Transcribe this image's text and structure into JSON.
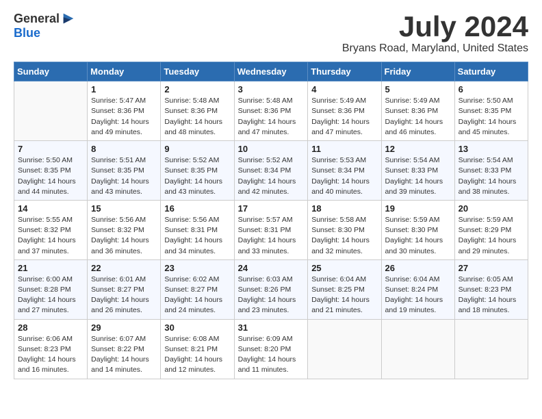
{
  "header": {
    "logo_general": "General",
    "logo_blue": "Blue",
    "month_title": "July 2024",
    "location": "Bryans Road, Maryland, United States"
  },
  "days_of_week": [
    "Sunday",
    "Monday",
    "Tuesday",
    "Wednesday",
    "Thursday",
    "Friday",
    "Saturday"
  ],
  "weeks": [
    [
      {
        "day": "",
        "info": ""
      },
      {
        "day": "1",
        "info": "Sunrise: 5:47 AM\nSunset: 8:36 PM\nDaylight: 14 hours\nand 49 minutes."
      },
      {
        "day": "2",
        "info": "Sunrise: 5:48 AM\nSunset: 8:36 PM\nDaylight: 14 hours\nand 48 minutes."
      },
      {
        "day": "3",
        "info": "Sunrise: 5:48 AM\nSunset: 8:36 PM\nDaylight: 14 hours\nand 47 minutes."
      },
      {
        "day": "4",
        "info": "Sunrise: 5:49 AM\nSunset: 8:36 PM\nDaylight: 14 hours\nand 47 minutes."
      },
      {
        "day": "5",
        "info": "Sunrise: 5:49 AM\nSunset: 8:36 PM\nDaylight: 14 hours\nand 46 minutes."
      },
      {
        "day": "6",
        "info": "Sunrise: 5:50 AM\nSunset: 8:35 PM\nDaylight: 14 hours\nand 45 minutes."
      }
    ],
    [
      {
        "day": "7",
        "info": "Sunrise: 5:50 AM\nSunset: 8:35 PM\nDaylight: 14 hours\nand 44 minutes."
      },
      {
        "day": "8",
        "info": "Sunrise: 5:51 AM\nSunset: 8:35 PM\nDaylight: 14 hours\nand 43 minutes."
      },
      {
        "day": "9",
        "info": "Sunrise: 5:52 AM\nSunset: 8:35 PM\nDaylight: 14 hours\nand 43 minutes."
      },
      {
        "day": "10",
        "info": "Sunrise: 5:52 AM\nSunset: 8:34 PM\nDaylight: 14 hours\nand 42 minutes."
      },
      {
        "day": "11",
        "info": "Sunrise: 5:53 AM\nSunset: 8:34 PM\nDaylight: 14 hours\nand 40 minutes."
      },
      {
        "day": "12",
        "info": "Sunrise: 5:54 AM\nSunset: 8:33 PM\nDaylight: 14 hours\nand 39 minutes."
      },
      {
        "day": "13",
        "info": "Sunrise: 5:54 AM\nSunset: 8:33 PM\nDaylight: 14 hours\nand 38 minutes."
      }
    ],
    [
      {
        "day": "14",
        "info": "Sunrise: 5:55 AM\nSunset: 8:32 PM\nDaylight: 14 hours\nand 37 minutes."
      },
      {
        "day": "15",
        "info": "Sunrise: 5:56 AM\nSunset: 8:32 PM\nDaylight: 14 hours\nand 36 minutes."
      },
      {
        "day": "16",
        "info": "Sunrise: 5:56 AM\nSunset: 8:31 PM\nDaylight: 14 hours\nand 34 minutes."
      },
      {
        "day": "17",
        "info": "Sunrise: 5:57 AM\nSunset: 8:31 PM\nDaylight: 14 hours\nand 33 minutes."
      },
      {
        "day": "18",
        "info": "Sunrise: 5:58 AM\nSunset: 8:30 PM\nDaylight: 14 hours\nand 32 minutes."
      },
      {
        "day": "19",
        "info": "Sunrise: 5:59 AM\nSunset: 8:30 PM\nDaylight: 14 hours\nand 30 minutes."
      },
      {
        "day": "20",
        "info": "Sunrise: 5:59 AM\nSunset: 8:29 PM\nDaylight: 14 hours\nand 29 minutes."
      }
    ],
    [
      {
        "day": "21",
        "info": "Sunrise: 6:00 AM\nSunset: 8:28 PM\nDaylight: 14 hours\nand 27 minutes."
      },
      {
        "day": "22",
        "info": "Sunrise: 6:01 AM\nSunset: 8:27 PM\nDaylight: 14 hours\nand 26 minutes."
      },
      {
        "day": "23",
        "info": "Sunrise: 6:02 AM\nSunset: 8:27 PM\nDaylight: 14 hours\nand 24 minutes."
      },
      {
        "day": "24",
        "info": "Sunrise: 6:03 AM\nSunset: 8:26 PM\nDaylight: 14 hours\nand 23 minutes."
      },
      {
        "day": "25",
        "info": "Sunrise: 6:04 AM\nSunset: 8:25 PM\nDaylight: 14 hours\nand 21 minutes."
      },
      {
        "day": "26",
        "info": "Sunrise: 6:04 AM\nSunset: 8:24 PM\nDaylight: 14 hours\nand 19 minutes."
      },
      {
        "day": "27",
        "info": "Sunrise: 6:05 AM\nSunset: 8:23 PM\nDaylight: 14 hours\nand 18 minutes."
      }
    ],
    [
      {
        "day": "28",
        "info": "Sunrise: 6:06 AM\nSunset: 8:23 PM\nDaylight: 14 hours\nand 16 minutes."
      },
      {
        "day": "29",
        "info": "Sunrise: 6:07 AM\nSunset: 8:22 PM\nDaylight: 14 hours\nand 14 minutes."
      },
      {
        "day": "30",
        "info": "Sunrise: 6:08 AM\nSunset: 8:21 PM\nDaylight: 14 hours\nand 12 minutes."
      },
      {
        "day": "31",
        "info": "Sunrise: 6:09 AM\nSunset: 8:20 PM\nDaylight: 14 hours\nand 11 minutes."
      },
      {
        "day": "",
        "info": ""
      },
      {
        "day": "",
        "info": ""
      },
      {
        "day": "",
        "info": ""
      }
    ]
  ]
}
